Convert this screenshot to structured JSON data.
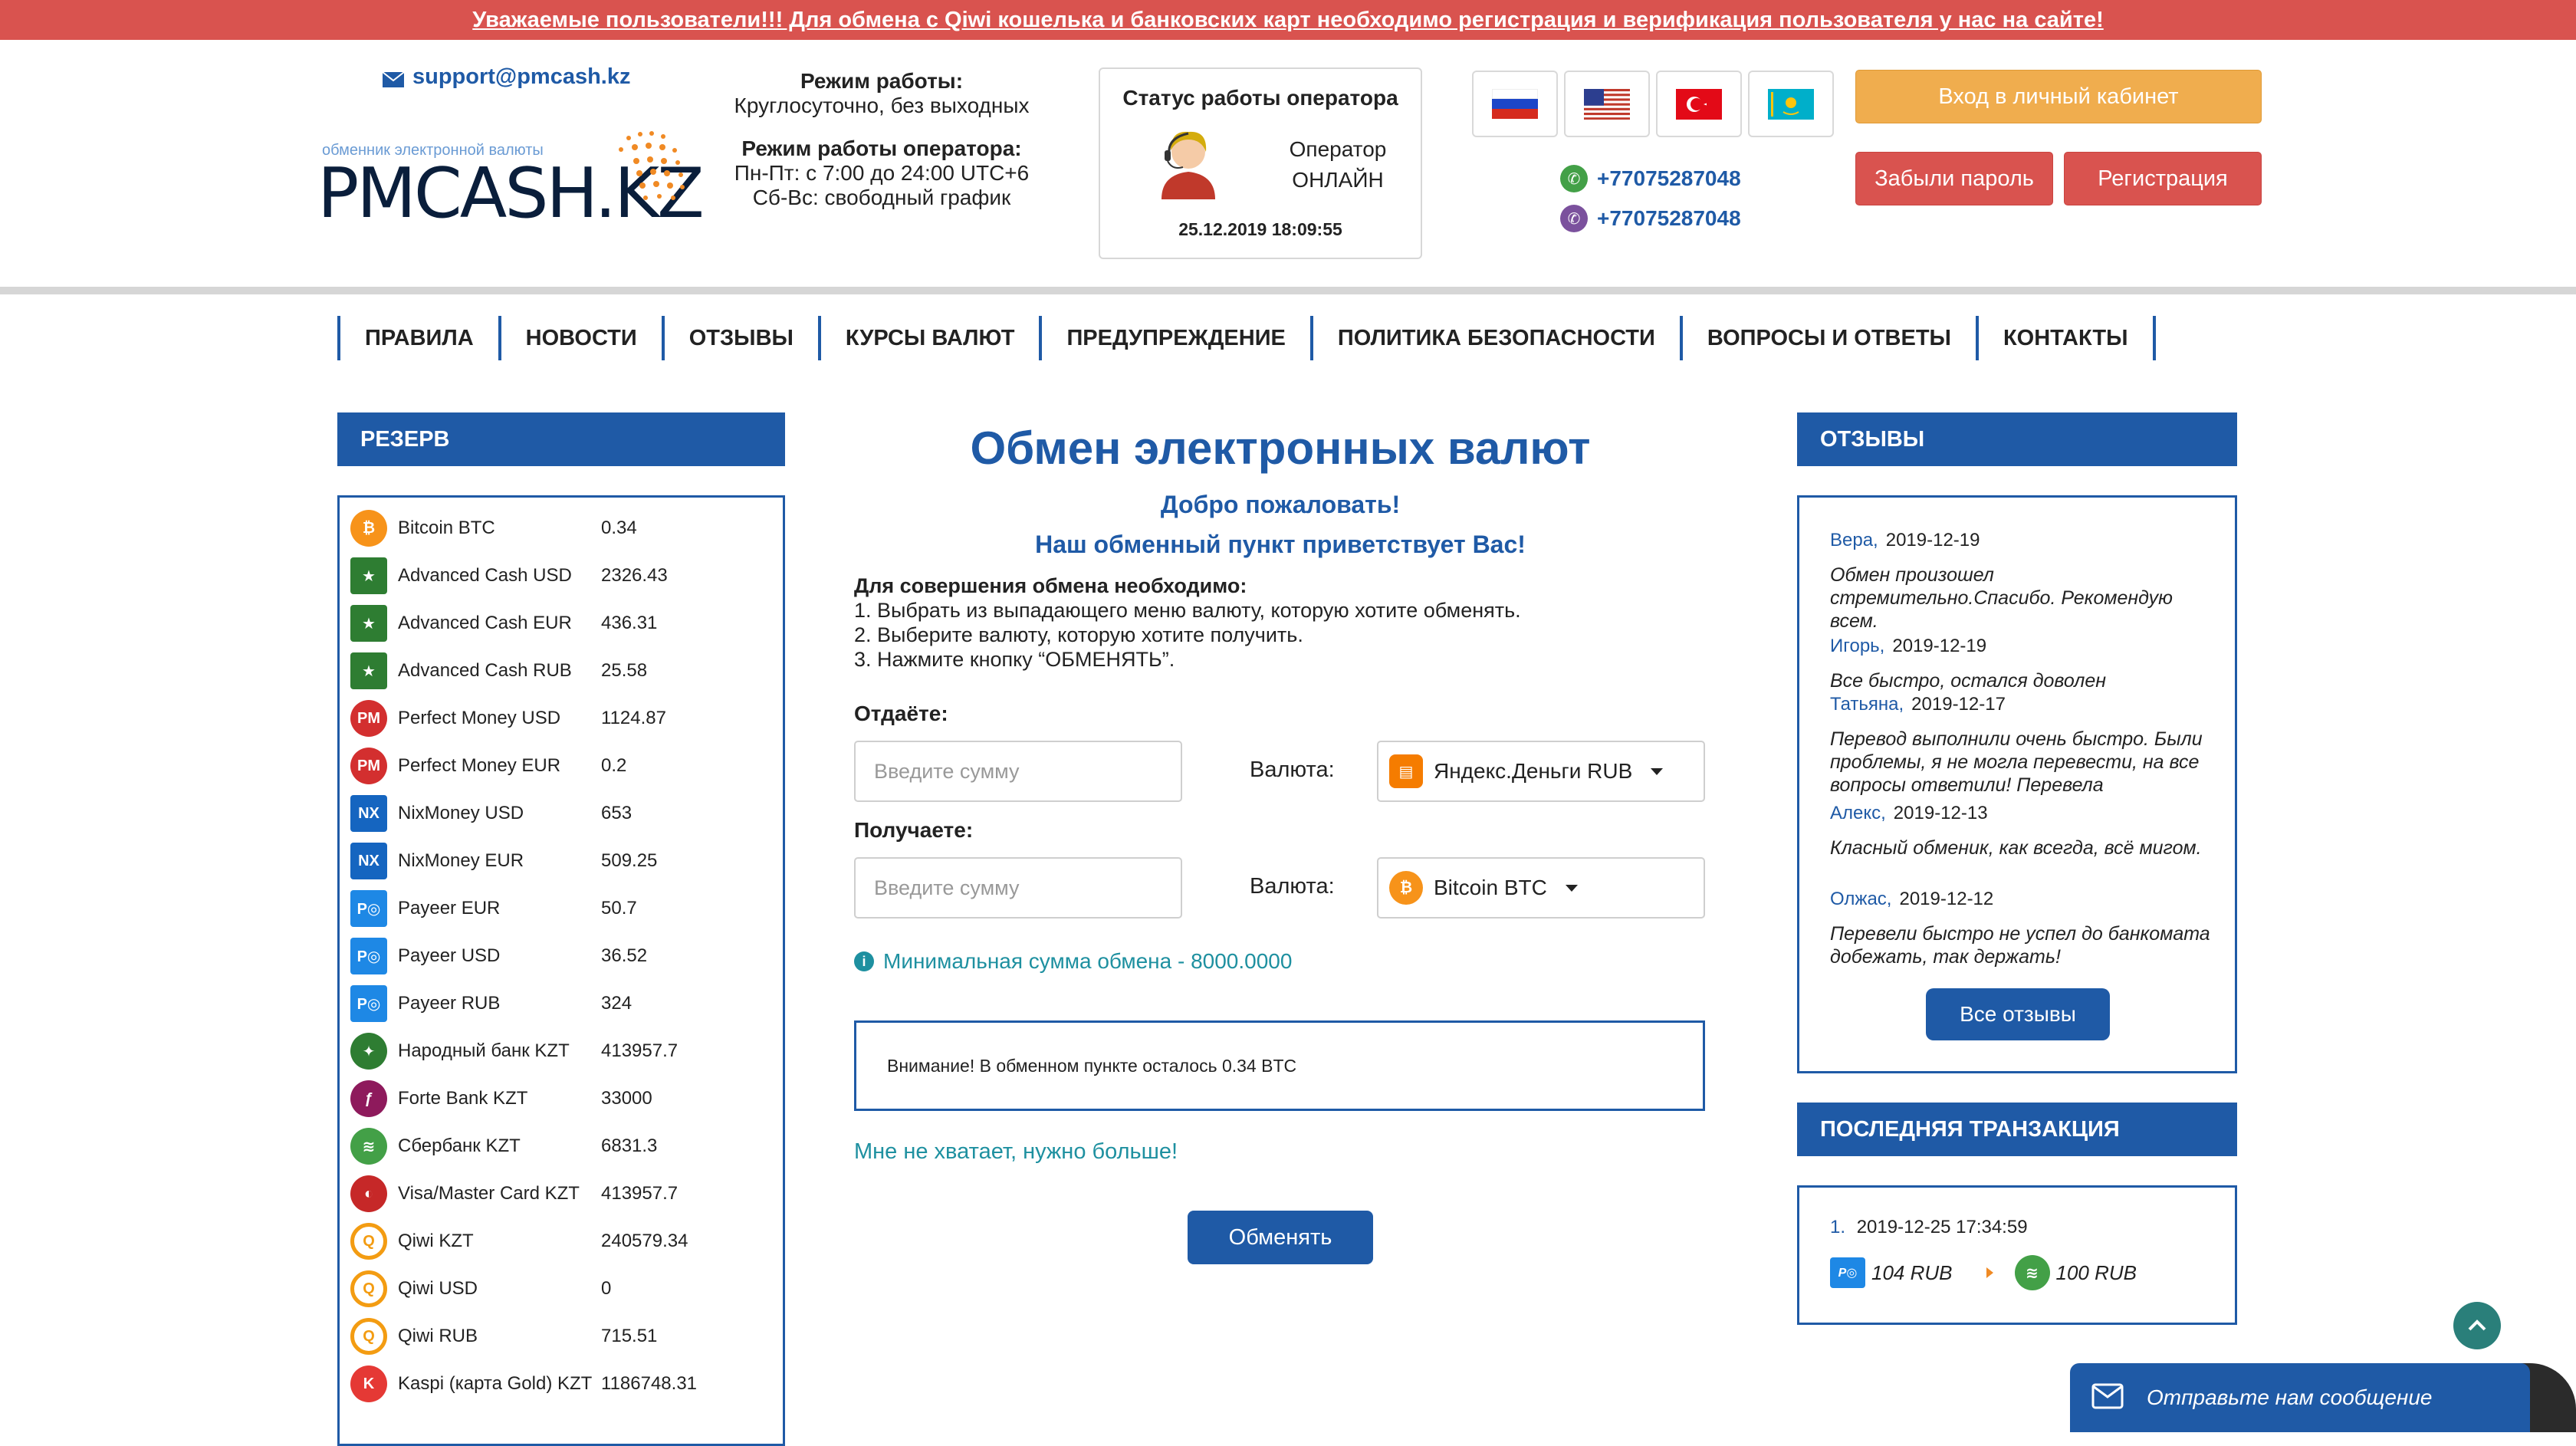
{
  "banner": "Уважаемые пользователи!!! Для обмена с Qiwi кошелька и банковских карт необходимо регистрация и верификация пользователя у нас на сайте!",
  "header": {
    "support_email": "support@pmcash.kz",
    "logo_subtitle": "обменник электронной валюты",
    "logo_text": "PMCASH.KZ",
    "hours_title": "Режим работы:",
    "hours_value": "Круглосуточно, без выходных",
    "op_hours_title": "Режим работы оператора:",
    "op_hours_line1": "Пн-Пт: с 7:00 до 24:00 UTC+6",
    "op_hours_line2": "Сб-Вс: свободный график",
    "status_title": "Статус работы оператора",
    "operator_label": "Оператор",
    "operator_status": "ОНЛАЙН",
    "status_datetime": "25.12.2019 18:09:55",
    "phone_whatsapp": "+77075287048",
    "phone_viber": "+77075287048",
    "login_button": "Вход в личный кабинет",
    "forgot_button": "Забыли пароль",
    "register_button": "Регистрация",
    "languages": [
      "ru-flag",
      "us-flag",
      "tr-flag",
      "kz-flag"
    ]
  },
  "nav": [
    "ПРАВИЛА",
    "НОВОСТИ",
    "ОТЗЫВЫ",
    "КУРСЫ ВАЛЮТ",
    "ПРЕДУПРЕЖДЕНИЕ",
    "ПОЛИТИКА БЕЗОПАСНОСТИ",
    "ВОПРОСЫ И ОТВЕТЫ",
    "КОНТАКТЫ"
  ],
  "reserve": {
    "title": "РЕЗЕРВ",
    "items": [
      {
        "name": "Bitcoin BTC",
        "value": "0.34",
        "icon": "bitcoin-icon",
        "color": "#f7931a"
      },
      {
        "name": "Advanced Cash USD",
        "value": "2326.43",
        "icon": "advcash-icon",
        "color": "#2e7d32"
      },
      {
        "name": "Advanced Cash EUR",
        "value": "436.31",
        "icon": "advcash-icon",
        "color": "#2e7d32"
      },
      {
        "name": "Advanced Cash RUB",
        "value": "25.58",
        "icon": "advcash-icon",
        "color": "#2e7d32"
      },
      {
        "name": "Perfect Money USD",
        "value": "1124.87",
        "icon": "perfect-money-icon",
        "color": "#d32f2f"
      },
      {
        "name": "Perfect Money EUR",
        "value": "0.2",
        "icon": "perfect-money-icon",
        "color": "#d32f2f"
      },
      {
        "name": "NixMoney USD",
        "value": "653",
        "icon": "nixmoney-icon",
        "color": "#1565c0"
      },
      {
        "name": "NixMoney EUR",
        "value": "509.25",
        "icon": "nixmoney-icon",
        "color": "#1565c0"
      },
      {
        "name": "Payeer EUR",
        "value": "50.7",
        "icon": "payeer-icon",
        "color": "#1e88e5"
      },
      {
        "name": "Payeer USD",
        "value": "36.52",
        "icon": "payeer-icon",
        "color": "#1e88e5"
      },
      {
        "name": "Payeer RUB",
        "value": "324",
        "icon": "payeer-icon",
        "color": "#1e88e5"
      },
      {
        "name": "Народный банк KZT",
        "value": "413957.7",
        "icon": "halyk-bank-icon",
        "color": "#2e7d32"
      },
      {
        "name": "Forte Bank KZT",
        "value": "33000",
        "icon": "forte-bank-icon",
        "color": "#8e1a5c"
      },
      {
        "name": "Сбербанк KZT",
        "value": "6831.3",
        "icon": "sberbank-icon",
        "color": "#43a047"
      },
      {
        "name": "Visa/Master Card KZT",
        "value": "413957.7",
        "icon": "visa-mastercard-icon",
        "color": "#c62828"
      },
      {
        "name": "Qiwi KZT",
        "value": "240579.34",
        "icon": "qiwi-icon",
        "color": "#f39c12"
      },
      {
        "name": "Qiwi USD",
        "value": "0",
        "icon": "qiwi-icon",
        "color": "#f39c12"
      },
      {
        "name": "Qiwi RUB",
        "value": "715.51",
        "icon": "qiwi-icon",
        "color": "#f39c12"
      },
      {
        "name": "Kaspi (карта Gold) KZT",
        "value": "1186748.31",
        "icon": "kaspi-icon",
        "color": "#e53935"
      }
    ]
  },
  "exchange": {
    "title": "Обмен электронных валют",
    "welcome": "Добро пожаловать!",
    "greeting": "Наш обменный пункт приветствует Вас!",
    "steps_title": "Для совершения обмена необходимо:",
    "step1": "1. Выбрать из выпадающего меню валюту, которую хотите обменять.",
    "step2": "2. Выберите валюту, которую хотите получить.",
    "step3": "3. Нажмите кнопку “ОБМЕНЯТЬ”.",
    "give_label": "Отдаёте:",
    "receive_label": "Получаете:",
    "amount_placeholder": "Введите сумму",
    "currency_label": "Валюта:",
    "give_currency": "Яндекс.Деньги RUB",
    "receive_currency": "Bitcoin BTC",
    "min_sum": "Минимальная сумма обмена - 8000.0000",
    "notice": "Внимание! В обменном пункте осталось 0.34 BTC",
    "need_more": "Мне не хватает, нужно больше!",
    "submit": "Обменять"
  },
  "reviews": {
    "title": "ОТЗЫВЫ",
    "items": [
      {
        "author": "Вера,",
        "date": "2019-12-19",
        "text": "Обмен произошел стремительно.Спасибо. Рекомендую всем."
      },
      {
        "author": "Игорь,",
        "date": "2019-12-19",
        "text": "Все быстро, остался доволен"
      },
      {
        "author": "Татьяна,",
        "date": "2019-12-17",
        "text": "Перевод выполнили очень быстро. Были проблемы, я не могла перевести, на все вопросы ответили! Перевела"
      },
      {
        "author": "Алекс,",
        "date": "2019-12-13",
        "text": "Класный обменик, как всегда, всё мигом."
      },
      {
        "author": "Олжас,",
        "date": "2019-12-12",
        "text": "Перевели быстро не успел до банкомата добежать, так держать!"
      }
    ],
    "all_button": "Все отзывы"
  },
  "last_transaction": {
    "title": "ПОСЛЕДНЯЯ ТРАНЗАКЦИЯ",
    "index": "1.",
    "datetime": "2019-12-25 17:34:59",
    "from_amount": "104 RUB",
    "to_amount": "100 RUB"
  },
  "chat": {
    "label": "Отправьте нам сообщение"
  }
}
